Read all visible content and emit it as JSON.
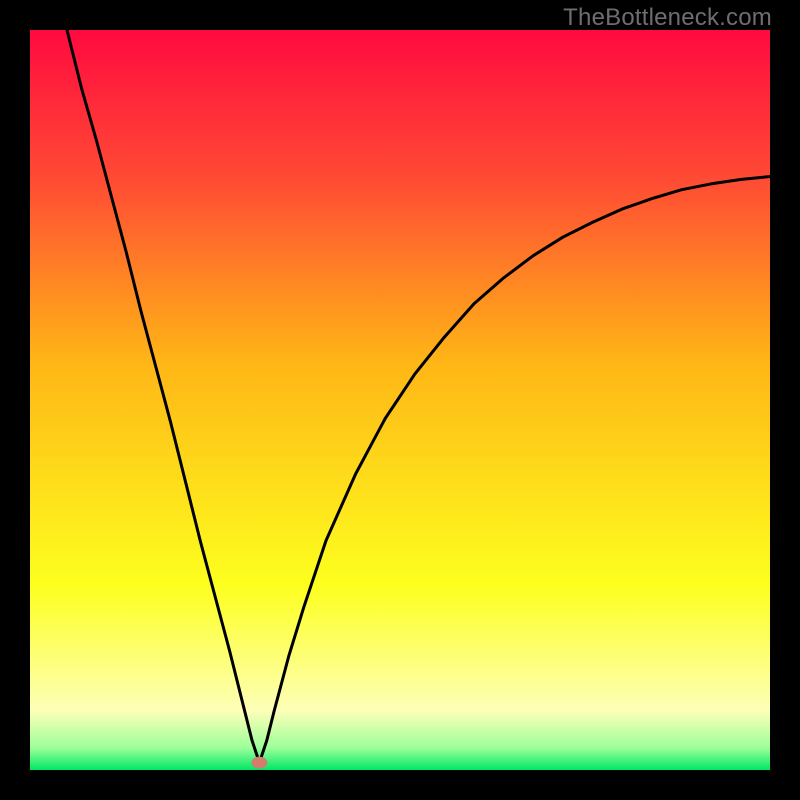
{
  "watermark": {
    "text": "TheBottleneck.com"
  },
  "chart_data": {
    "type": "line",
    "title": "",
    "xlabel": "",
    "ylabel": "",
    "xlim": [
      0,
      100
    ],
    "ylim": [
      0,
      100
    ],
    "grid": false,
    "legend": false,
    "background_gradient": {
      "stops": [
        {
          "pos": 0.0,
          "color": "#ff0a3f"
        },
        {
          "pos": 0.2,
          "color": "#ff4a34"
        },
        {
          "pos": 0.45,
          "color": "#ffb616"
        },
        {
          "pos": 0.75,
          "color": "#fdff1e"
        },
        {
          "pos": 0.92,
          "color": "#fdffb8"
        },
        {
          "pos": 0.97,
          "color": "#9dff9a"
        },
        {
          "pos": 1.0,
          "color": "#00e765"
        }
      ]
    },
    "marker": {
      "x": 31,
      "y": 1,
      "color": "#d17e6c",
      "r": 1.4
    },
    "series": [
      {
        "name": "curve",
        "color": "#000000",
        "x": [
          5,
          7,
          9,
          11,
          13,
          15,
          17,
          19,
          21,
          23,
          25,
          27,
          29,
          30,
          31,
          32,
          33,
          35,
          37,
          40,
          44,
          48,
          52,
          56,
          60,
          64,
          68,
          72,
          76,
          80,
          84,
          88,
          92,
          96,
          100
        ],
        "y": [
          100,
          92,
          85,
          77.5,
          70,
          62,
          54.5,
          47,
          39,
          31,
          23.5,
          16,
          8,
          4,
          1,
          4,
          8,
          15.5,
          22,
          31,
          40,
          47.5,
          53.5,
          58.5,
          63,
          66.5,
          69.5,
          72,
          74,
          75.8,
          77.2,
          78.4,
          79.2,
          79.8,
          80.2
        ]
      }
    ]
  }
}
